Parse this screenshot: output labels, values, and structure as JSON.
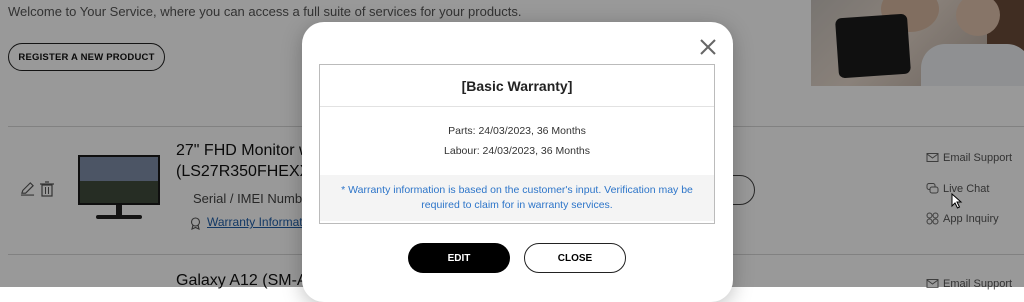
{
  "page": {
    "welcome_text": "Welcome to Your Service, where you can access a full suite of services for your products.",
    "register_button": "REGISTER A NEW PRODUCT"
  },
  "products": [
    {
      "title_line1": "27\" FHD Monitor w",
      "title_line2": "(LS27R350FHEXX",
      "serial_label": "Serial / IMEI Numb",
      "warranty_link": "Warranty Informat"
    },
    {
      "title_line1": "Galaxy A12 (SM-A"
    }
  ],
  "side_links": {
    "email_support": "Email Support",
    "live_chat": "Live Chat",
    "app_inquiry": "App Inquiry",
    "email_support_2": "Email Support"
  },
  "modal": {
    "title": "[Basic Warranty]",
    "parts": "Parts: 24/03/2023, 36 Months",
    "labour": "Labour: 24/03/2023, 36 Months",
    "notice": "* Warranty information is based on the customer's input. Verification may be required to claim for in warranty services.",
    "edit_button": "EDIT",
    "close_button": "CLOSE"
  },
  "icons": [
    "edit-icon",
    "trash-icon",
    "warranty-icon",
    "email-icon",
    "chat-icon",
    "app-icon",
    "close-icon",
    "cursor-icon"
  ]
}
